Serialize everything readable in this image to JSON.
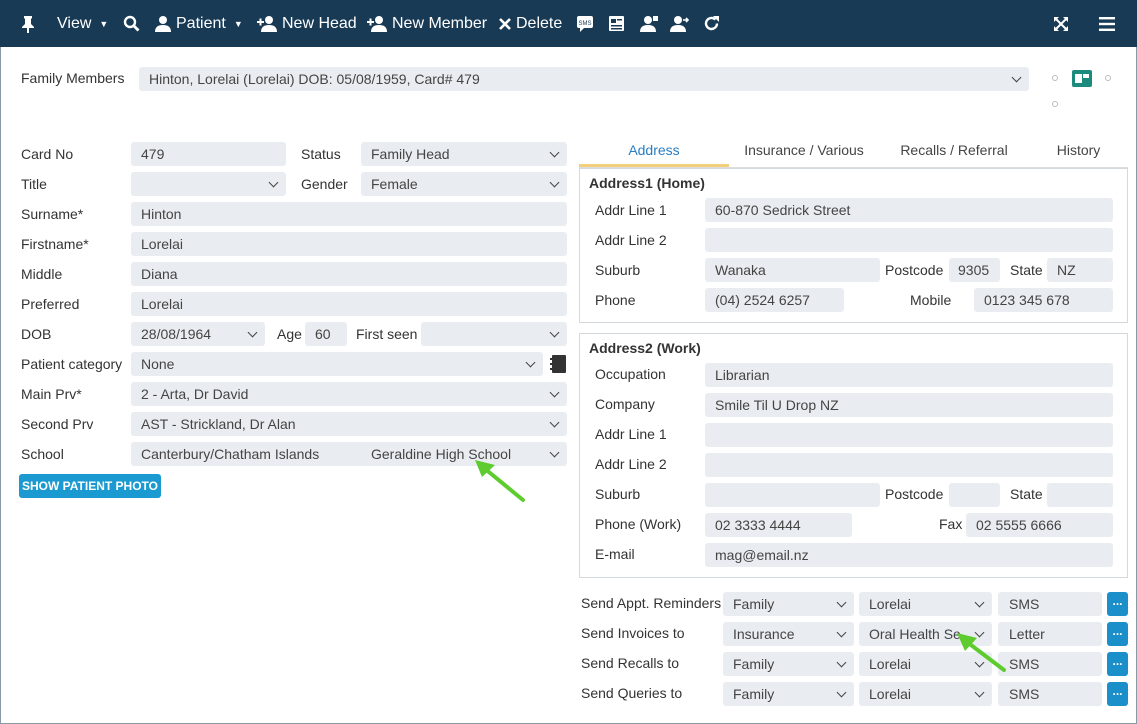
{
  "toolbar": {
    "view": "View",
    "patient": "Patient",
    "new_head": "New Head",
    "new_member": "New Member",
    "delete": "Delete"
  },
  "family": {
    "label": "Family Members",
    "value": "Hinton, Lorelai (Lorelai) DOB: 05/08/1959, Card# 479"
  },
  "patient": {
    "card_no": {
      "label": "Card No",
      "value": "479"
    },
    "status": {
      "label": "Status",
      "value": "Family Head"
    },
    "title": {
      "label": "Title",
      "value": ""
    },
    "gender": {
      "label": "Gender",
      "value": "Female"
    },
    "surname": {
      "label": "Surname*",
      "value": "Hinton"
    },
    "firstname": {
      "label": "Firstname*",
      "value": "Lorelai"
    },
    "middle": {
      "label": "Middle",
      "value": "Diana"
    },
    "preferred": {
      "label": "Preferred",
      "value": "Lorelai"
    },
    "dob": {
      "label": "DOB",
      "value": "28/08/1964"
    },
    "age": {
      "label": "Age",
      "value": "60"
    },
    "first_seen": {
      "label": "First seen",
      "value": ""
    },
    "category": {
      "label": "Patient category",
      "value": "None"
    },
    "main_prv": {
      "label": "Main Prv*",
      "value": "2 - Arta, Dr David"
    },
    "second_prv": {
      "label": "Second Prv",
      "value": "AST - Strickland, Dr Alan"
    },
    "school": {
      "label": "School",
      "region": "Canterbury/Chatham Islands",
      "value": "Geraldine High School"
    },
    "photo_button": "SHOW PATIENT PHOTO"
  },
  "tabs": [
    "Address",
    "Insurance / Various",
    "Recalls / Referral",
    "History"
  ],
  "address1": {
    "title": "Address1 (Home)",
    "line1": {
      "label": "Addr Line 1",
      "value": "60-870 Sedrick Street"
    },
    "line2": {
      "label": "Addr Line 2",
      "value": ""
    },
    "suburb": {
      "label": "Suburb",
      "value": "Wanaka"
    },
    "postcode": {
      "label": "Postcode",
      "value": "9305"
    },
    "state": {
      "label": "State",
      "value": "NZ"
    },
    "phone": {
      "label": "Phone",
      "value": "(04) 2524 6257"
    },
    "mobile": {
      "label": "Mobile",
      "value": "0123 345 678"
    }
  },
  "address2": {
    "title": "Address2 (Work)",
    "occupation": {
      "label": "Occupation",
      "value": "Librarian"
    },
    "company": {
      "label": "Company",
      "value": "Smile Til U Drop NZ"
    },
    "line1": {
      "label": "Addr Line 1",
      "value": ""
    },
    "line2": {
      "label": "Addr Line 2",
      "value": ""
    },
    "suburb": {
      "label": "Suburb",
      "value": ""
    },
    "postcode": {
      "label": "Postcode",
      "value": ""
    },
    "state": {
      "label": "State",
      "value": ""
    },
    "phone_work": {
      "label": "Phone (Work)",
      "value": "02 3333 4444"
    },
    "fax": {
      "label": "Fax",
      "value": "02 5555 6666"
    },
    "email": {
      "label": "E-mail",
      "value": "mag@email.nz"
    }
  },
  "sending": [
    {
      "label": "Send Appt. Reminders",
      "to": "Family",
      "person": "Lorelai",
      "method": "SMS"
    },
    {
      "label": "Send Invoices to",
      "to": "Insurance",
      "person": "Oral Health Se",
      "method": "Letter"
    },
    {
      "label": "Send Recalls to",
      "to": "Family",
      "person": "Lorelai",
      "method": "SMS"
    },
    {
      "label": "Send Queries to",
      "to": "Family",
      "person": "Lorelai",
      "method": "SMS"
    }
  ],
  "more_button": "...",
  "colors": {
    "topbar": "#183a55",
    "accent": "#1a9ad0",
    "field_bg": "#e9edf1",
    "arrow": "#5ecb2e"
  }
}
